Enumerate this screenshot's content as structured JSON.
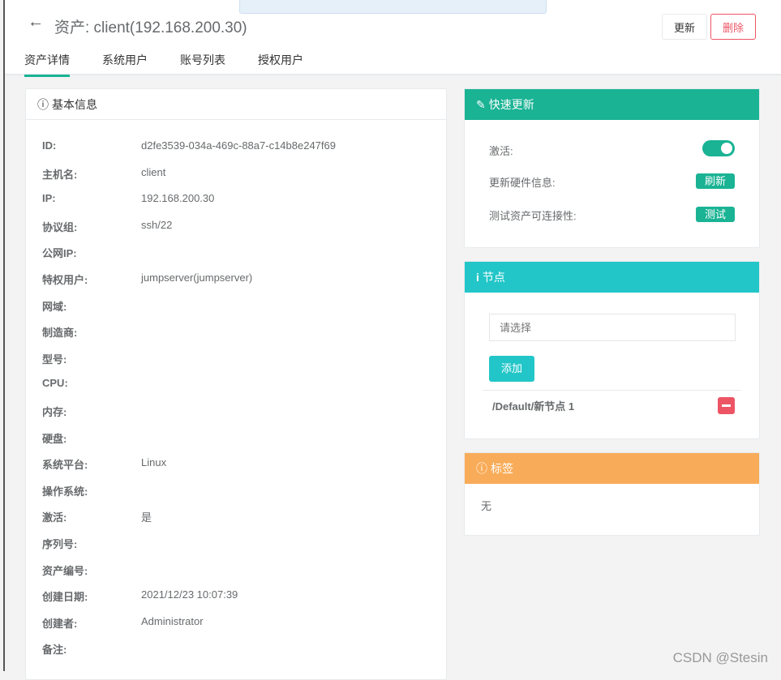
{
  "header": {
    "title": "资产: client(192.168.200.30)",
    "update_label": "更新",
    "delete_label": "删除"
  },
  "tabs": [
    {
      "label": "资产详情"
    },
    {
      "label": "系统用户"
    },
    {
      "label": "账号列表"
    },
    {
      "label": "授权用户"
    }
  ],
  "basic": {
    "title": "基本信息",
    "rows": [
      {
        "k": "ID:",
        "v": "d2fe3539-034a-469c-88a7-c14b8e247f69"
      },
      {
        "k": "主机名:",
        "v": "client"
      },
      {
        "k": "IP:",
        "v": "192.168.200.30"
      },
      {
        "k": "协议组:",
        "v": "ssh/22"
      },
      {
        "k": "公网IP:",
        "v": ""
      },
      {
        "k": "特权用户:",
        "v": "jumpserver(jumpserver)"
      },
      {
        "k": "网域:",
        "v": ""
      },
      {
        "k": "制造商:",
        "v": ""
      },
      {
        "k": "型号:",
        "v": ""
      },
      {
        "k": "CPU:",
        "v": ""
      },
      {
        "k": "内存:",
        "v": ""
      },
      {
        "k": "硬盘:",
        "v": ""
      },
      {
        "k": "系统平台:",
        "v": "Linux"
      },
      {
        "k": "操作系统:",
        "v": ""
      },
      {
        "k": "激活:",
        "v": "是"
      },
      {
        "k": "序列号:",
        "v": ""
      },
      {
        "k": "资产编号:",
        "v": ""
      },
      {
        "k": "创建日期:",
        "v": "2021/12/23 10:07:39"
      },
      {
        "k": "创建者:",
        "v": "Administrator"
      },
      {
        "k": "备注:",
        "v": ""
      }
    ]
  },
  "quick": {
    "title": "快速更新",
    "active_label": "激活:",
    "active": true,
    "hw_label": "更新硬件信息:",
    "hw_btn": "刷新",
    "test_label": "测试资产可连接性:",
    "test_btn": "测试"
  },
  "nodes": {
    "title": "节点",
    "placeholder": "请选择",
    "add_label": "添加",
    "items": [
      {
        "path": "/Default/新节点 1"
      }
    ]
  },
  "labels": {
    "title": "标签",
    "value": "无"
  },
  "watermark": "CSDN @Stesin",
  "colors": {
    "primary": "#1ab394",
    "info": "#23c6c8",
    "warning": "#f8ac59",
    "danger": "#ed5565"
  }
}
